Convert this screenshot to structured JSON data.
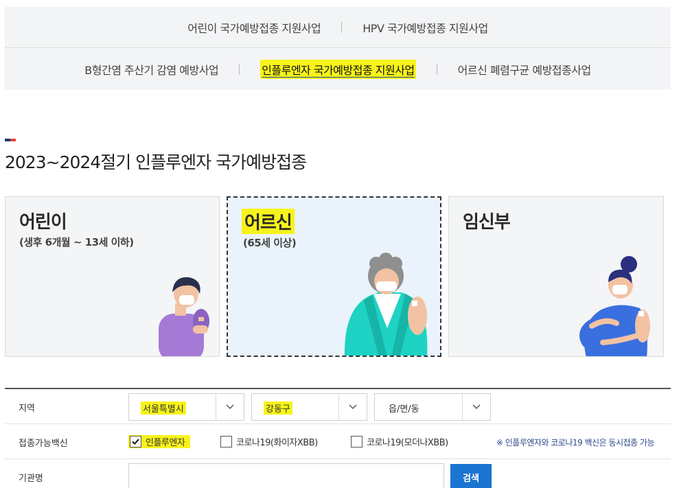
{
  "tabs": {
    "row1": [
      "어린이 국가예방접종 지원사업",
      "HPV 국가예방접종 지원사업"
    ],
    "row2": [
      "B형간염 주산기 감염 예방사업",
      "인플루엔자 국가예방접종 지원사업",
      "어르신 폐렴구균 예방접종사업"
    ],
    "active": "인플루엔자 국가예방접종 지원사업"
  },
  "section": {
    "title": "2023~2024절기 인플루엔자 국가예방접종"
  },
  "cards": [
    {
      "title": "어린이",
      "subtitle": "(생후 6개월 ~ 13세 이하)"
    },
    {
      "title": "어르신",
      "subtitle": "(65세 이상)",
      "selected": true
    },
    {
      "title": "임신부",
      "subtitle": ""
    }
  ],
  "form": {
    "region_label": "지역",
    "city_value": "서울특별시",
    "district_value": "강동구",
    "town_placeholder": "읍/면/동",
    "vaccine_label": "접종가능백신",
    "vaccines": [
      {
        "label": "인플루엔자",
        "checked": true
      },
      {
        "label": "코로나19(화이자XBB)",
        "checked": false
      },
      {
        "label": "코로나19(모더나XBB)",
        "checked": false
      }
    ],
    "note": "※ 인플루엔자와 코로나19 백신은 동시접종 가능",
    "org_label": "기관명",
    "org_value": "",
    "search_button": "검색"
  },
  "colors": {
    "highlight": "#f7f31a",
    "accent_blue": "#1a74d1",
    "selected_card_bg": "#eaf3fb"
  }
}
